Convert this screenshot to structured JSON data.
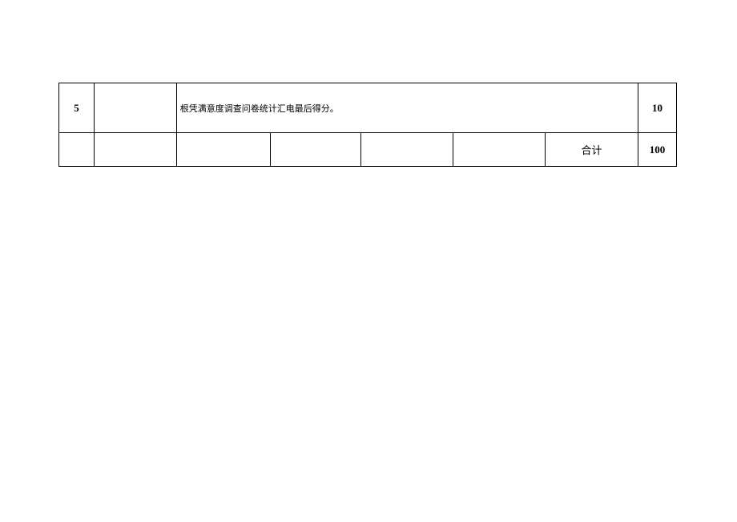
{
  "table": {
    "row1": {
      "number": "5",
      "description": "根凭满意度调查问卷统计汇电最后得分。",
      "score": "10"
    },
    "row2": {
      "total_label": "合计",
      "total_value": "100"
    }
  }
}
